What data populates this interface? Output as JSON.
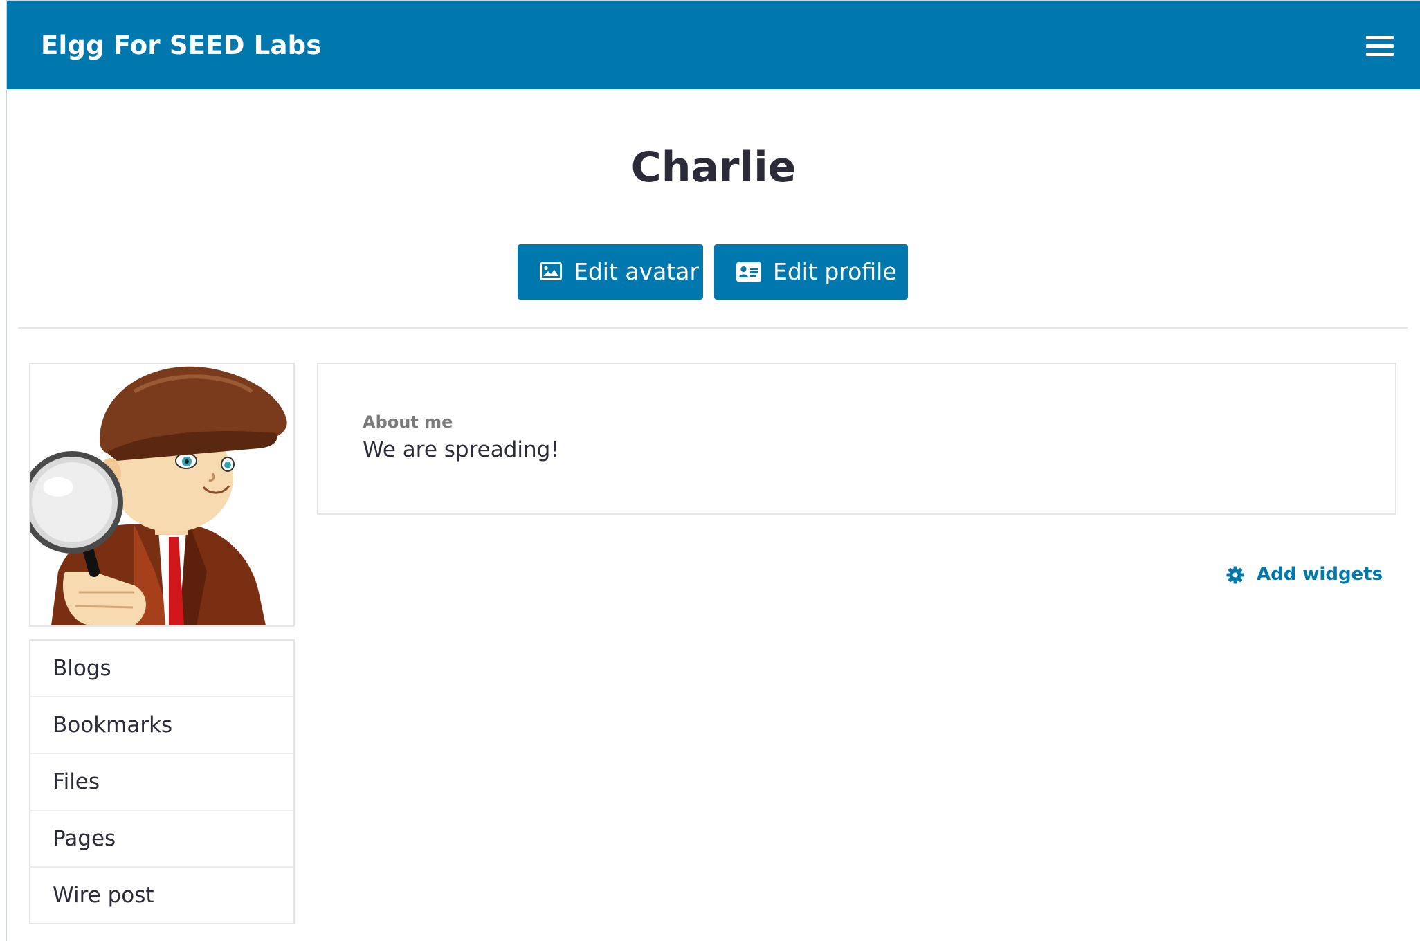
{
  "header": {
    "brand": "Elgg For SEED Labs",
    "menu_icon": "hamburger-menu-icon",
    "background_color": "#0078ad"
  },
  "profile": {
    "name": "Charlie",
    "edit_avatar_label": "Edit avatar",
    "edit_avatar_icon": "image-icon",
    "edit_profile_label": "Edit profile",
    "edit_profile_icon": "id-card-icon",
    "avatar_image": "detective-cartoon-avatar"
  },
  "owner_menu": {
    "items": [
      {
        "label": "Blogs"
      },
      {
        "label": "Bookmarks"
      },
      {
        "label": "Files"
      },
      {
        "label": "Pages"
      },
      {
        "label": "Wire post"
      }
    ]
  },
  "about": {
    "label": "About me",
    "value": "We are spreading!"
  },
  "widgets": {
    "add_label": "Add widgets",
    "add_icon": "gear-icon"
  },
  "colors": {
    "accent": "#0078ad",
    "text": "#2b2b3a",
    "muted": "#7a7a7a",
    "border": "#e6e6e6"
  }
}
